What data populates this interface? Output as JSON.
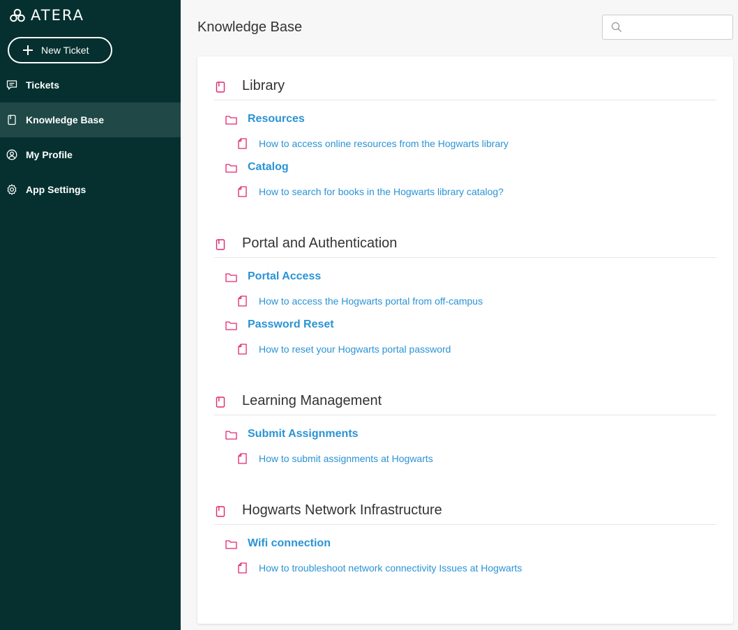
{
  "app": {
    "logo_text": "ATERA",
    "new_ticket_label": "New Ticket"
  },
  "nav": {
    "items": [
      {
        "label": "Tickets",
        "icon": "chat-icon",
        "active": false
      },
      {
        "label": "Knowledge Base",
        "icon": "book-icon",
        "active": true
      },
      {
        "label": "My Profile",
        "icon": "user-icon",
        "active": false
      },
      {
        "label": "App Settings",
        "icon": "gear-icon",
        "active": false
      }
    ]
  },
  "header": {
    "title": "Knowledge Base",
    "search_placeholder": ""
  },
  "colors": {
    "sidebar_bg": "#05302f",
    "sidebar_active": "#1f4846",
    "link": "#2a93d5",
    "icon_accent": "#e0266f"
  },
  "sections": [
    {
      "title": "Library",
      "folders": [
        {
          "title": "Resources",
          "articles": [
            "How to access online resources from the Hogwarts library"
          ]
        },
        {
          "title": "Catalog",
          "articles": [
            "How to search for books in the Hogwarts library catalog?"
          ]
        }
      ]
    },
    {
      "title": "Portal and Authentication",
      "folders": [
        {
          "title": "Portal Access",
          "articles": [
            "How to access the Hogwarts portal from off-campus"
          ]
        },
        {
          "title": "Password Reset",
          "articles": [
            "How to reset your Hogwarts portal password"
          ]
        }
      ]
    },
    {
      "title": "Learning Management",
      "folders": [
        {
          "title": "Submit Assignments",
          "articles": [
            "How to submit assignments at Hogwarts"
          ]
        }
      ]
    },
    {
      "title": "Hogwarts Network Infrastructure",
      "folders": [
        {
          "title": "Wifi connection",
          "articles": [
            "How to troubleshoot network connectivity Issues at Hogwarts"
          ]
        }
      ]
    }
  ]
}
